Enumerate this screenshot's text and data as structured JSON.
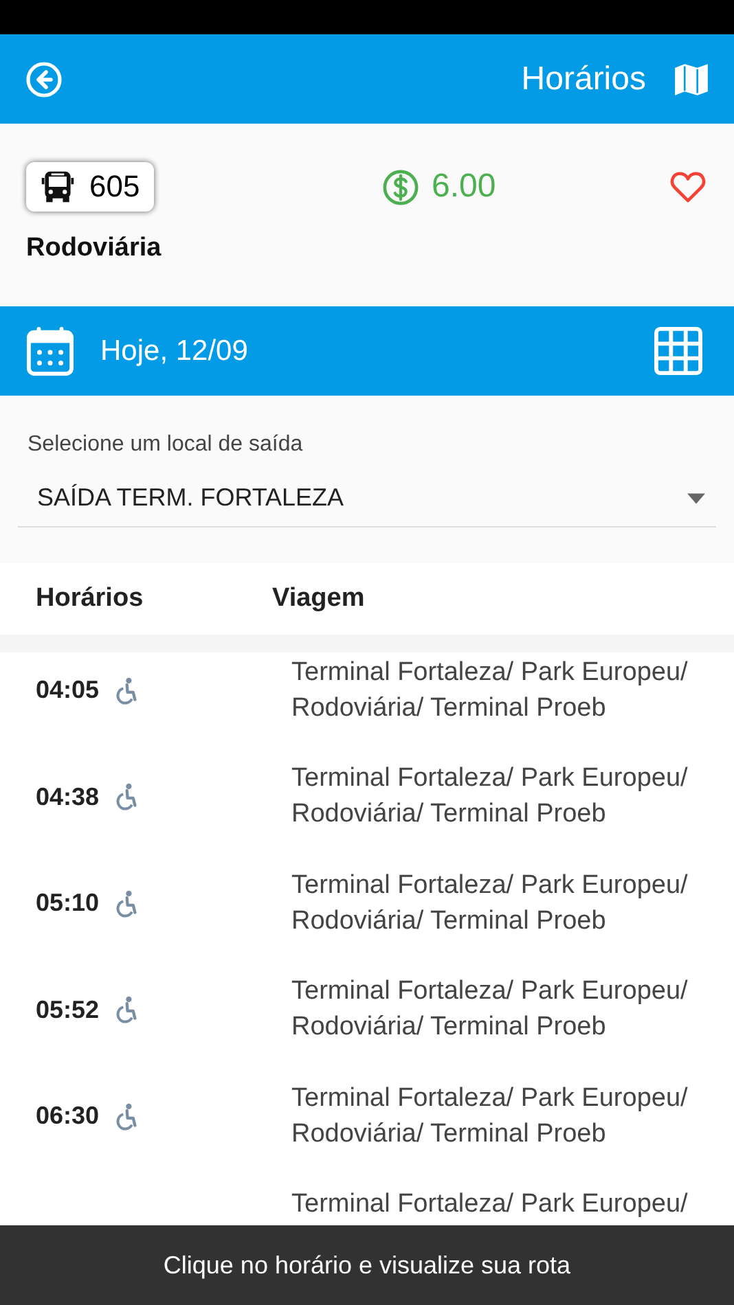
{
  "header": {
    "title": "Horários"
  },
  "line": {
    "number": "605",
    "fare": "6.00",
    "favorite": false,
    "destination": "Rodoviária"
  },
  "date_bar": {
    "label": "Hoje, 12/09"
  },
  "departure": {
    "label": "Selecione um local de saída",
    "value": "SAÍDA TERM. FORTALEZA"
  },
  "table": {
    "columns": [
      "Horários",
      "Viagem"
    ],
    "rows": [
      {
        "time": "04:05",
        "accessible": true,
        "trip": "Terminal Fortaleza/ Park Europeu/ Rodoviária/ Terminal Proeb"
      },
      {
        "time": "04:38",
        "accessible": true,
        "trip": "Terminal Fortaleza/ Park Europeu/ Rodoviária/ Terminal Proeb"
      },
      {
        "time": "05:10",
        "accessible": true,
        "trip": "Terminal Fortaleza/ Park Europeu/ Rodoviária/ Terminal Proeb"
      },
      {
        "time": "05:52",
        "accessible": true,
        "trip": "Terminal Fortaleza/ Park Europeu/ Rodoviária/ Terminal Proeb"
      },
      {
        "time": "06:30",
        "accessible": true,
        "trip": "Terminal Fortaleza/ Park Europeu/ Rodoviária/ Terminal Proeb"
      },
      {
        "trip": "Terminal Fortaleza/ Park Europeu/"
      }
    ]
  },
  "snackbar": {
    "text": "Clique no horário e visualize sua rota"
  }
}
